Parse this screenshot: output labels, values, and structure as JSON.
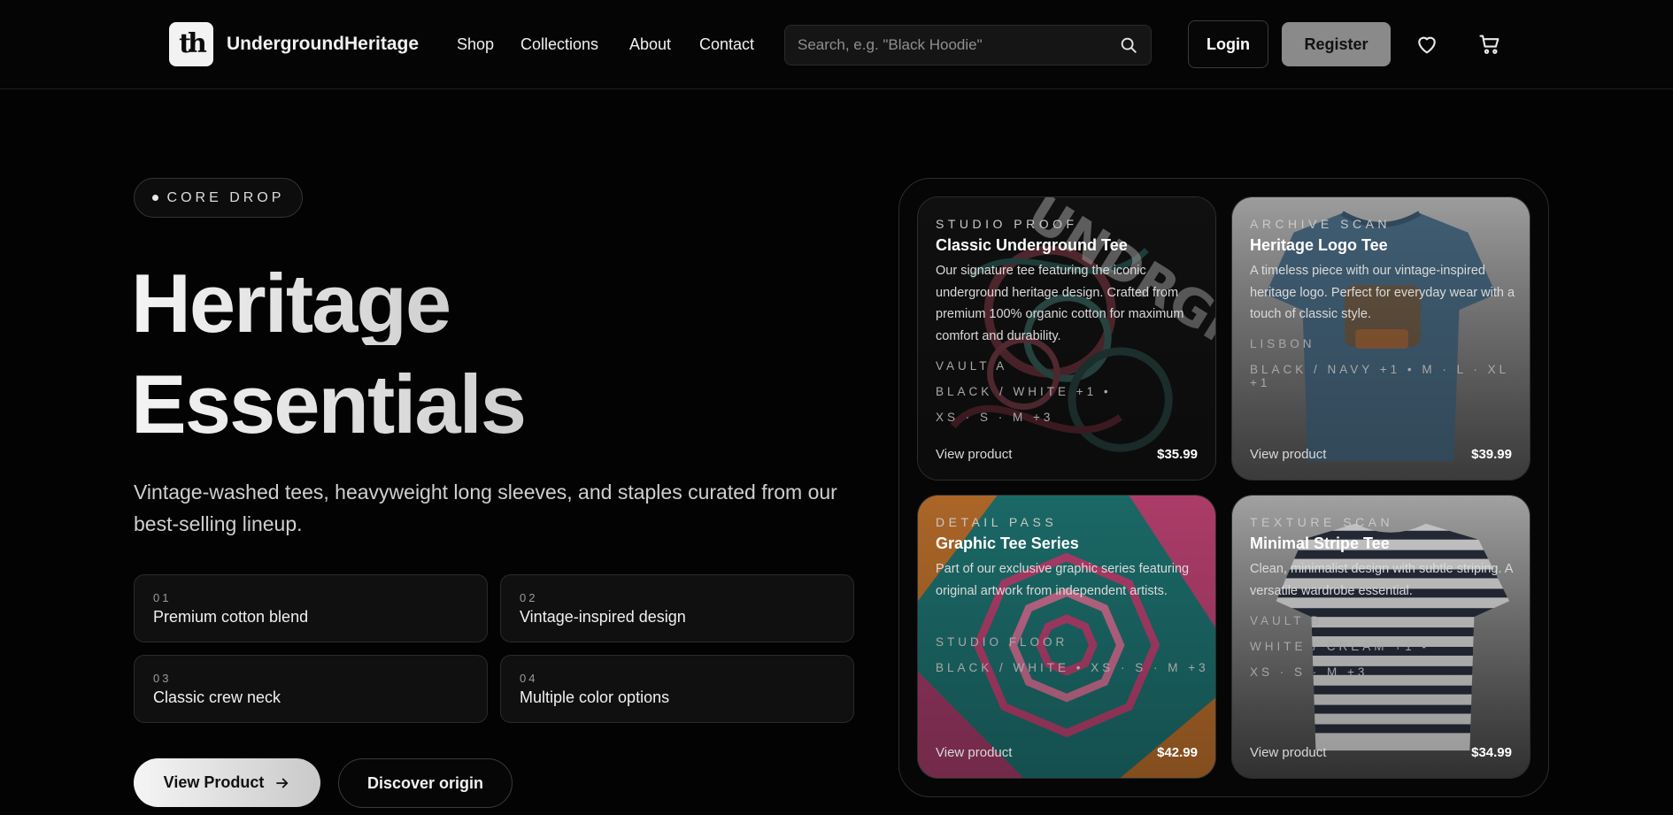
{
  "header": {
    "brand_name": "UndergroundHeritage",
    "logo_monogram": "th",
    "nav": [
      "Shop",
      "Collections",
      "About",
      "Contact"
    ],
    "search_placeholder": "Search, e.g. \"Black Hoodie\"",
    "login_label": "Login",
    "register_label": "Register",
    "icons": [
      "search-icon",
      "heart-icon",
      "cart-icon"
    ]
  },
  "hero": {
    "badge": "CORE DROP",
    "title_line1": "Heritage",
    "title_line2": "Essentials",
    "lead": "Vintage-washed tees, heavyweight long sleeves, and staples curated from our best-selling lineup.",
    "features": [
      {
        "num": "01",
        "label": "Premium cotton blend"
      },
      {
        "num": "02",
        "label": "Vintage-inspired design"
      },
      {
        "num": "03",
        "label": "Classic crew neck"
      },
      {
        "num": "04",
        "label": "Multiple color options"
      }
    ],
    "primary_cta": "View Product",
    "secondary_cta": "Discover origin"
  },
  "products": [
    {
      "eyebrow": "STUDIO PROOF",
      "title": "Classic Underground Tee",
      "description": "Our signature tee featuring the iconic underground heritage design. Crafted from premium 100% organic cotton for maximum comfort and durability.",
      "meta": [
        "VAULT A",
        "BLACK / WHITE +1 •",
        "XS · S · M +3"
      ],
      "link": "View product",
      "price": "$35.99"
    },
    {
      "eyebrow": "ARCHIVE SCAN",
      "title": "Heritage Logo Tee",
      "description": "A timeless piece with our vintage-inspired heritage logo. Perfect for everyday wear with a touch of classic style.",
      "meta": [
        "LISBON",
        "BLACK / NAVY +1 • M · L · XL +1"
      ],
      "link": "View product",
      "price": "$39.99"
    },
    {
      "eyebrow": "DETAIL PASS",
      "title": "Graphic Tee Series",
      "description": "Part of our exclusive graphic series featuring original artwork from independent artists.",
      "meta": [
        "STUDIO FLOOR",
        "BLACK / WHITE • XS · S · M +3"
      ],
      "link": "View product",
      "price": "$42.99"
    },
    {
      "eyebrow": "TEXTURE SCAN",
      "title": "Minimal Stripe Tee",
      "description": "Clean, minimalist design with subtle striping. A versatile wardrobe essential.",
      "meta": [
        "VAULT B",
        "WHITE / CREAM +1 •",
        "XS · S · M +3"
      ],
      "link": "View product",
      "price": "$34.99"
    }
  ],
  "colors": {
    "background": "#030303",
    "register_bg": "#8a8a8a",
    "card_teal": "#1f7a78",
    "card_pink": "#c9477a",
    "tee_blue": "#4b6d86"
  }
}
